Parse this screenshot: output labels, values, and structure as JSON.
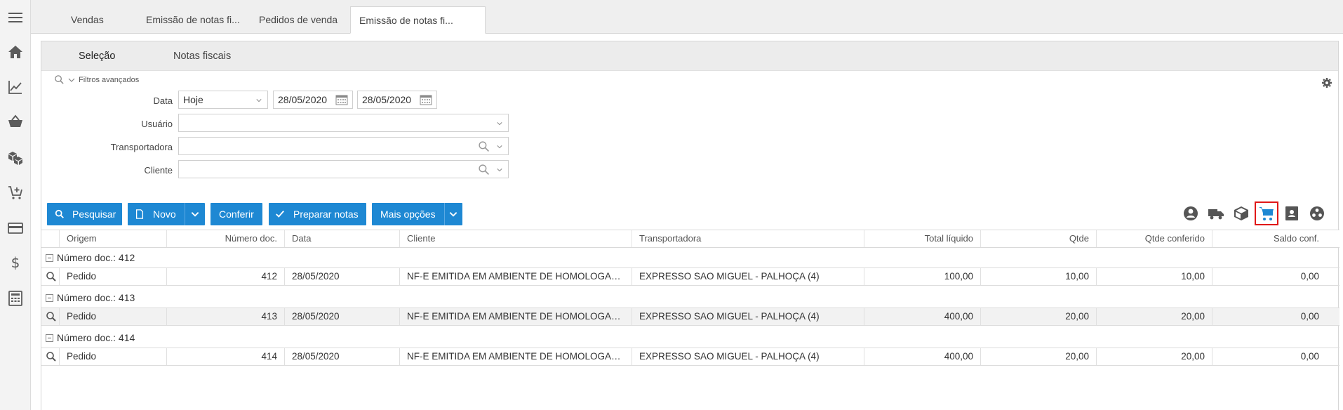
{
  "tabs": [
    {
      "label": "Vendas"
    },
    {
      "label": "Emissão de notas fi..."
    },
    {
      "label": "Pedidos de venda"
    },
    {
      "label": "Emissão de notas fi..."
    }
  ],
  "subtabs": {
    "selecao": "Seleção",
    "notas": "Notas fiscais"
  },
  "filters": {
    "toggle_label": "Filtros avançados",
    "data_label": "Data",
    "data_period": "Hoje",
    "date_from": "28/05/2020",
    "date_to": "28/05/2020",
    "usuario_label": "Usuário",
    "usuario_value": "",
    "transportadora_label": "Transportadora",
    "transportadora_value": "",
    "cliente_label": "Cliente",
    "cliente_value": ""
  },
  "toolbar": {
    "pesquisar": "Pesquisar",
    "novo": "Novo",
    "conferir": "Conferir",
    "preparar": "Preparar notas",
    "mais": "Mais opções"
  },
  "right_icons": [
    "person-circle-icon",
    "truck-icon",
    "box-icon",
    "cart-icon",
    "contact-card-icon",
    "group-circle-icon"
  ],
  "grid": {
    "columns": [
      "Origem",
      "Número doc.",
      "Data",
      "Cliente",
      "Transportadora",
      "Total líquido",
      "Qtde",
      "Qtde conferido",
      "Saldo conf."
    ],
    "groups": [
      {
        "title": "Número doc.: 412",
        "row": {
          "origem": "Pedido",
          "numero": "412",
          "data": "28/05/2020",
          "cliente": "NF-E EMITIDA EM AMBIENTE DE HOMOLOGAC...",
          "transportadora": "EXPRESSO SAO MIGUEL - PALHOÇA (4)",
          "total": "100,00",
          "qtde": "10,00",
          "conferido": "10,00",
          "saldo": "0,00"
        }
      },
      {
        "title": "Número doc.: 413",
        "row": {
          "origem": "Pedido",
          "numero": "413",
          "data": "28/05/2020",
          "cliente": "NF-E EMITIDA EM AMBIENTE DE HOMOLOGAC...",
          "transportadora": "EXPRESSO SAO MIGUEL - PALHOÇA (4)",
          "total": "400,00",
          "qtde": "20,00",
          "conferido": "20,00",
          "saldo": "0,00"
        }
      },
      {
        "title": "Número doc.: 414",
        "row": {
          "origem": "Pedido",
          "numero": "414",
          "data": "28/05/2020",
          "cliente": "NF-E EMITIDA EM AMBIENTE DE HOMOLOGAC...",
          "transportadora": "EXPRESSO SAO MIGUEL - PALHOÇA (4)",
          "total": "400,00",
          "qtde": "20,00",
          "conferido": "20,00",
          "saldo": "0,00"
        }
      }
    ]
  },
  "colors": {
    "accent": "#1e88d3",
    "highlight_border": "#e01818"
  }
}
